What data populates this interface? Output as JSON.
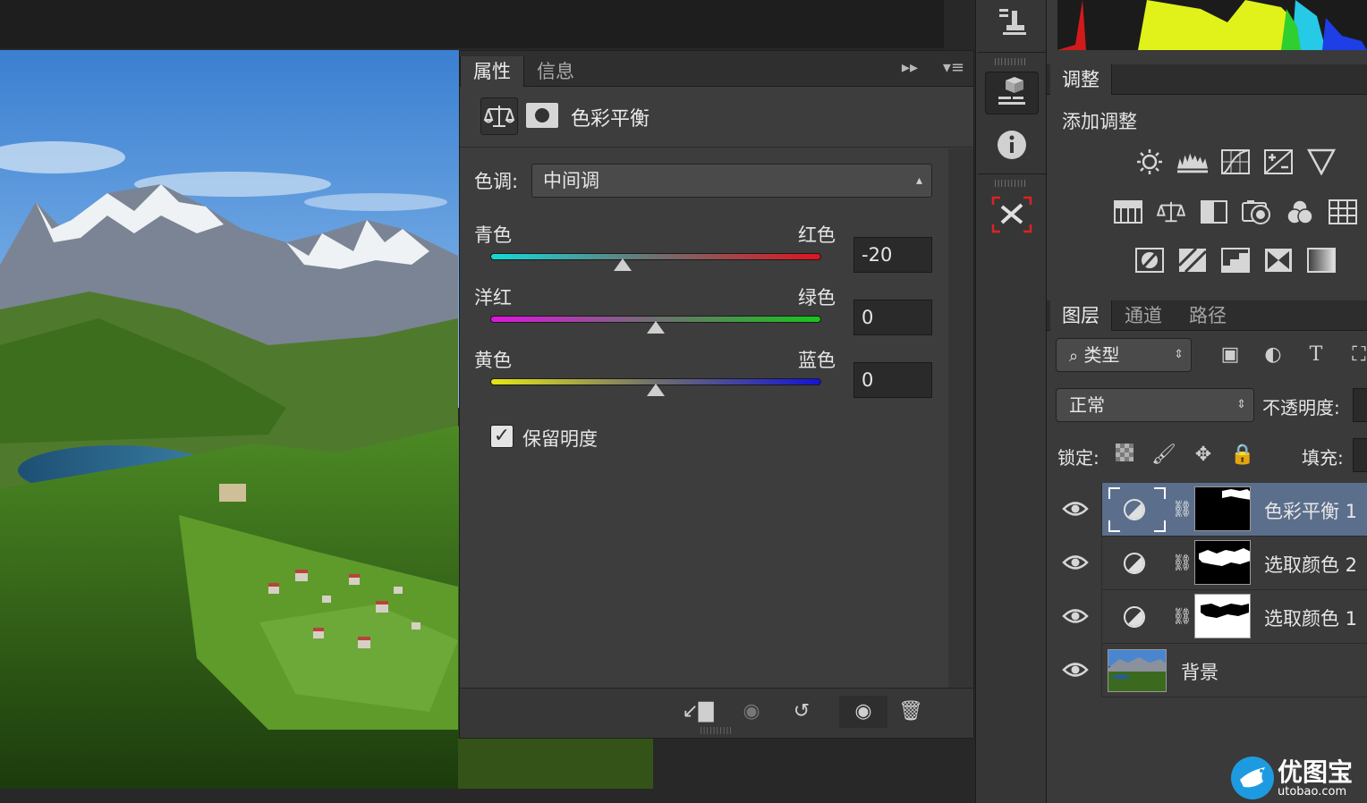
{
  "properties": {
    "tabs": [
      {
        "label": "属性"
      },
      {
        "label": "信息"
      }
    ],
    "title": "色彩平衡",
    "tone_label": "色调:",
    "tone_value": "中间调",
    "sliders": [
      {
        "left": "青色",
        "right": "红色",
        "value": "-20",
        "level": 0.4
      },
      {
        "left": "洋红",
        "right": "绿色",
        "value": "0",
        "level": 0.5
      },
      {
        "left": "黄色",
        "right": "蓝色",
        "value": "0",
        "level": 0.5
      }
    ],
    "preserve_label": "保留明度",
    "preserve_checked": true
  },
  "adjustments": {
    "tab": "调整",
    "add_label": "添加调整"
  },
  "layers_panel": {
    "tabs": [
      {
        "label": "图层"
      },
      {
        "label": "通道"
      },
      {
        "label": "路径"
      }
    ],
    "filter_label": "类型",
    "blend_mode": "正常",
    "opacity_label": "不透明度:",
    "lock_label": "锁定:",
    "fill_label": "填充:",
    "layers": [
      {
        "name": "色彩平衡 1",
        "selected": true
      },
      {
        "name": "选取颜色 2",
        "selected": false
      },
      {
        "name": "选取颜色 1",
        "selected": false
      },
      {
        "name": "背景",
        "selected": false
      }
    ]
  },
  "watermark": {
    "name": "优图宝",
    "url": "utobao.com"
  },
  "colors": {
    "selection": "#5b6f8c",
    "panel": "#3d3d3d",
    "dark": "#282828"
  }
}
